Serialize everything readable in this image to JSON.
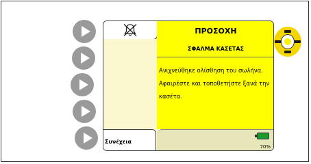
{
  "alarm": {
    "title": "ΠΡΟΣΟΧΗ",
    "subtitle": "ΣΦΑΛΜΑ ΚΑΣΕΤΑΣ",
    "message": "Ανιχνεύθηκε ολίσθηση του σωλήνα. Αφαιρέστε και τοποθετήστε ξανά την κασέτα."
  },
  "softkeys": {
    "continue_label": "Συνέχεια"
  },
  "status": {
    "battery_percent": "70%",
    "battery_level": 0.7
  },
  "icons": {
    "alarm_silenced": "bell-silenced-icon",
    "battery": "battery-icon",
    "alarm_light": "alarm-light-icon"
  },
  "colors": {
    "alarm_yellow": "#ffff00",
    "screen_background": "#fbf8d0",
    "softkey_gray": "#9a9a9a",
    "battery_green": "#1a9a2a"
  }
}
